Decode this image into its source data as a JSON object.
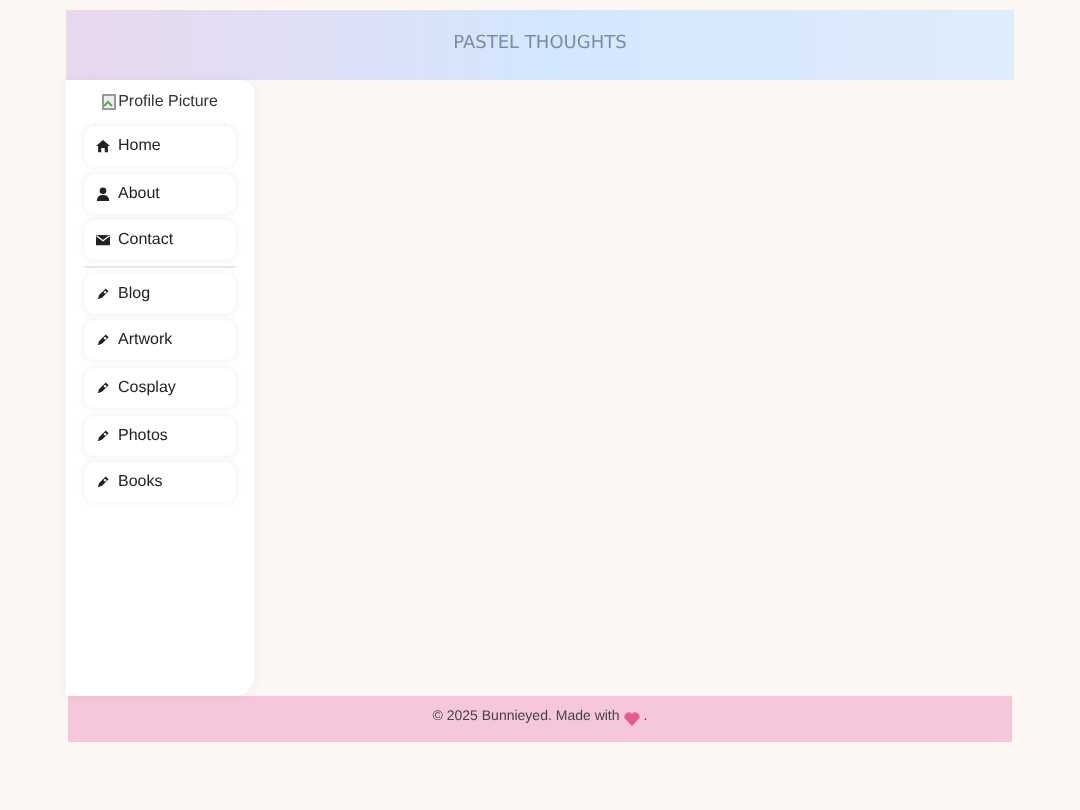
{
  "header": {
    "title": "PASTEL THOUGHTS"
  },
  "sidebar": {
    "profile_alt": "Profile Picture",
    "groups": [
      [
        {
          "label": "Home",
          "kind": "home"
        },
        {
          "label": "About",
          "kind": "user"
        },
        {
          "label": "Contact",
          "kind": "envelope"
        }
      ],
      [
        {
          "label": "Blog",
          "kind": "pen"
        },
        {
          "label": "Artwork",
          "kind": "pen"
        },
        {
          "label": "Cosplay",
          "kind": "pen"
        },
        {
          "label": "Photos",
          "kind": "pen"
        },
        {
          "label": "Books",
          "kind": "pen"
        }
      ]
    ]
  },
  "footer": {
    "text": "© 2025 Bunnieyed. Made with",
    "end": "."
  }
}
